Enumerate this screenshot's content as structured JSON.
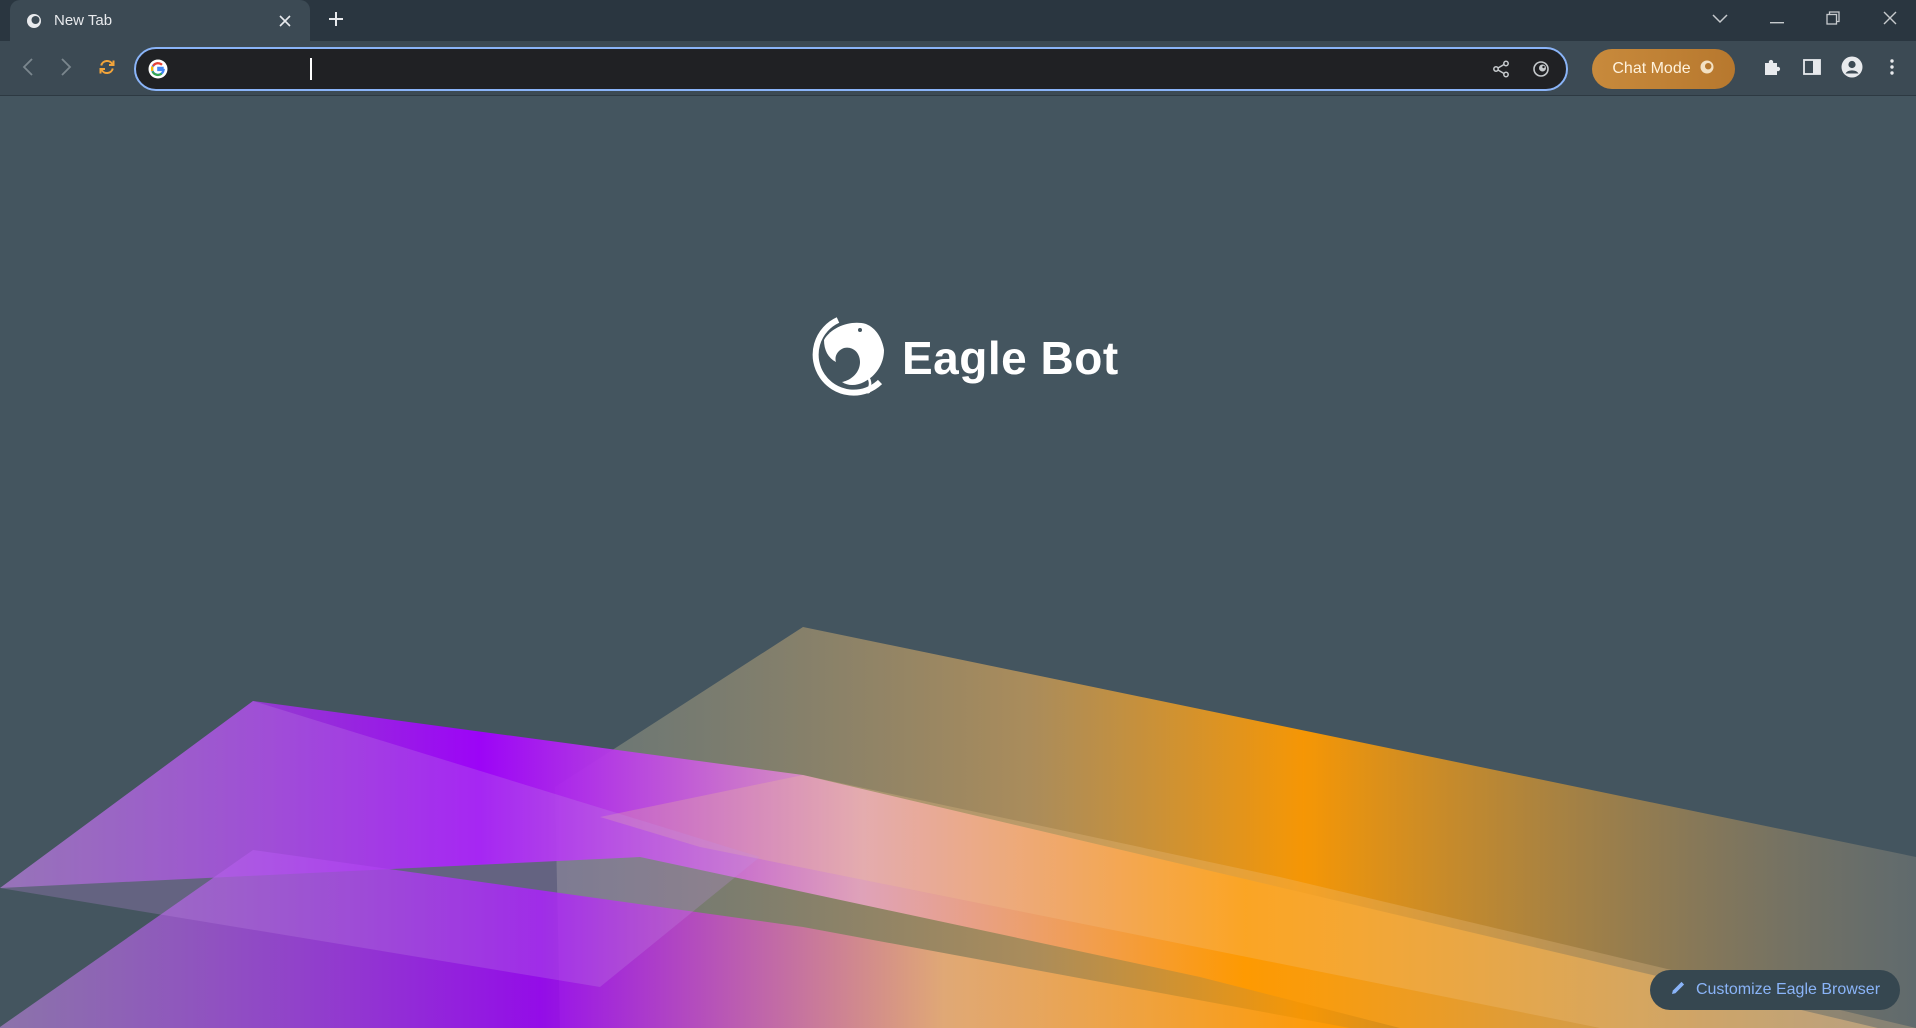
{
  "tab": {
    "title": "New Tab",
    "close_icon": "close-icon",
    "favicon": "eagle-favicon-icon"
  },
  "tabstrip": {
    "new_tab_icon": "plus-icon"
  },
  "window_controls": [
    "chevron-down-icon",
    "minimize-icon",
    "restore-icon",
    "close-icon"
  ],
  "toolbar": {
    "back_icon": "arrow-left-icon",
    "forward_icon": "arrow-right-icon",
    "reload_icon": "reload-icon",
    "chat_mode_label": "Chat Mode",
    "extensions_icon": "puzzle-icon",
    "sidepanel_icon": "side-panel-icon",
    "profile_icon": "avatar-icon",
    "menu_icon": "kebab-menu-icon"
  },
  "omnibox": {
    "value": "",
    "search_engine_icon": "google-icon",
    "share_icon": "share-icon",
    "eagle_icon": "eagle-icon"
  },
  "main": {
    "brand_name": "Eagle Bot",
    "customize_label": "Customize Eagle Browser"
  },
  "colors": {
    "accent_blue": "#8ab4f8",
    "chat_mode": "#c88a3c",
    "background": "#44555f",
    "purple": "#a100ff",
    "orange": "#ff9a00"
  }
}
